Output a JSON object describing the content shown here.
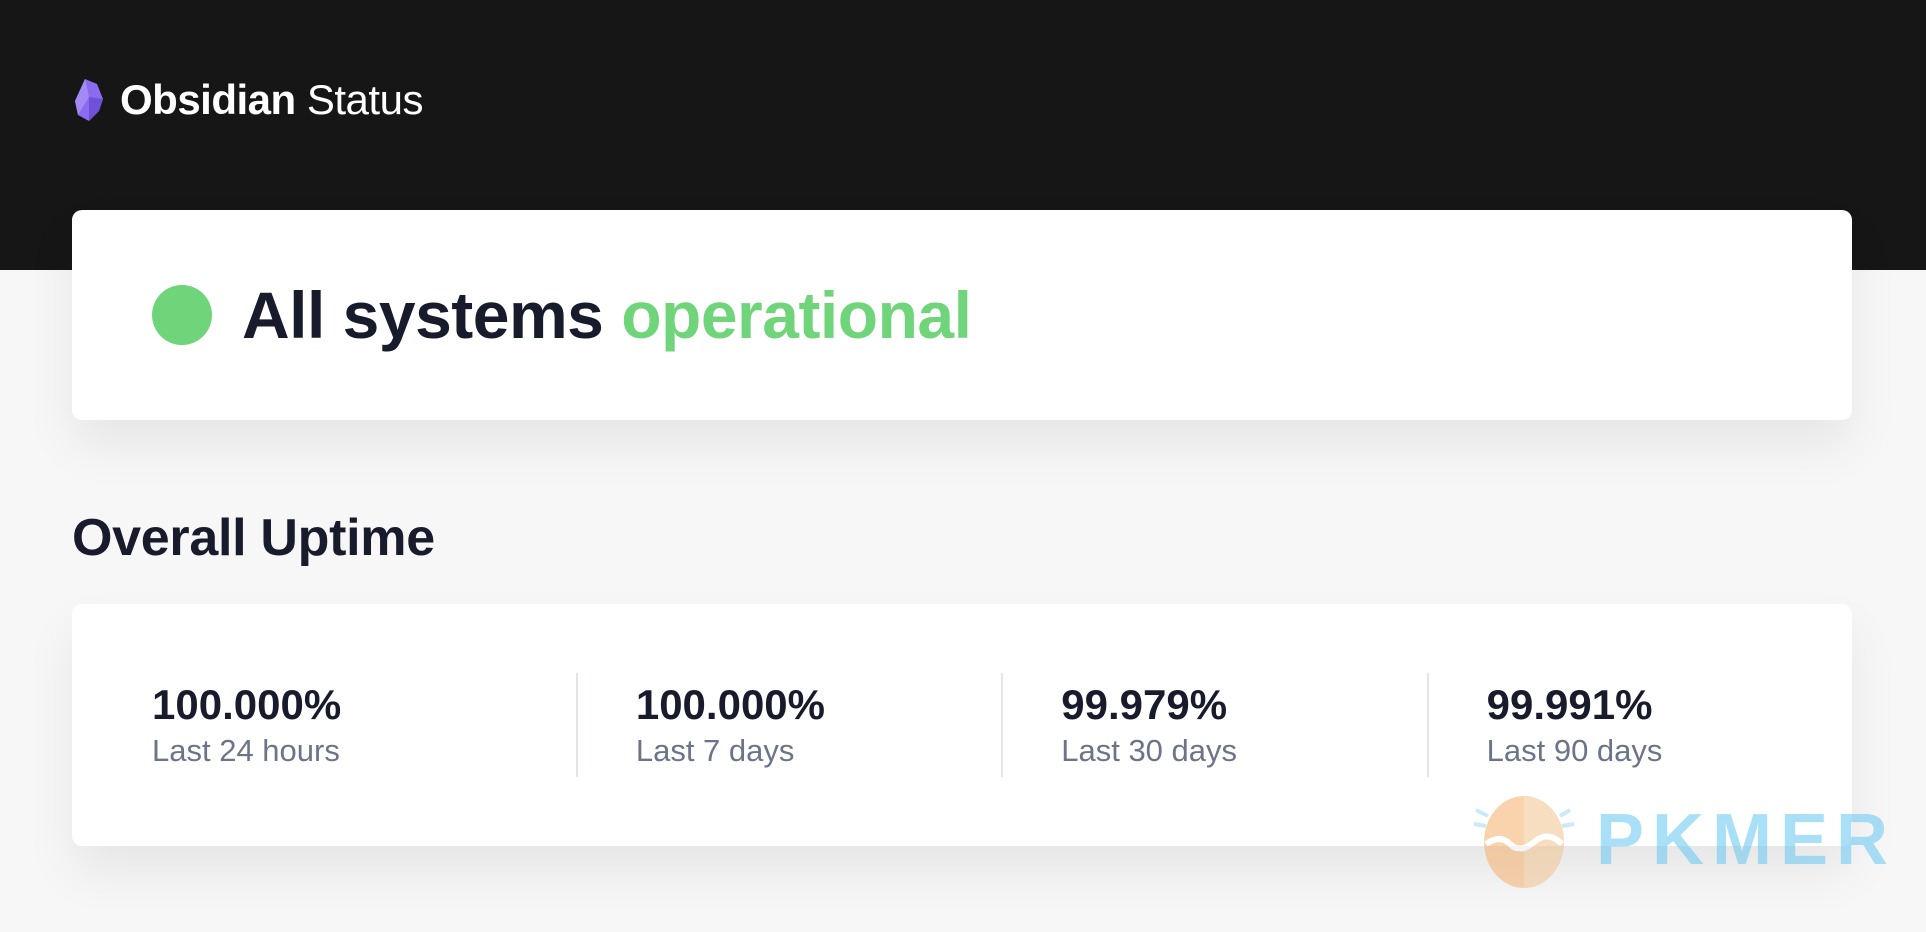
{
  "header": {
    "brand_name": "Obsidian",
    "brand_suffix": "Status",
    "logo_icon": "obsidian-logo-icon",
    "background": "#161616",
    "logo_color": "#8b6cef"
  },
  "status": {
    "prefix": "All systems",
    "state": "operational",
    "indicator_color": "#70d47b"
  },
  "uptime": {
    "title": "Overall Uptime",
    "metrics": [
      {
        "value": "100.000%",
        "label": "Last 24 hours"
      },
      {
        "value": "100.000%",
        "label": "Last 7 days"
      },
      {
        "value": "99.979%",
        "label": "Last 30 days"
      },
      {
        "value": "99.991%",
        "label": "Last 90 days"
      }
    ]
  },
  "watermark": {
    "text": "PKMER",
    "icon": "pkmer-egg-logo-icon"
  }
}
